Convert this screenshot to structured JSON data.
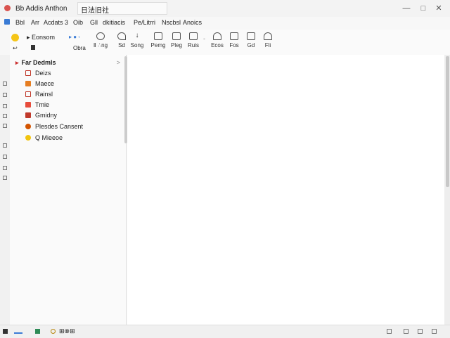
{
  "window": {
    "title": "Bb Addis Anthon",
    "title_field": "日法旧社",
    "controls": {
      "minimize": "—",
      "maximize": "□",
      "close": "✕"
    }
  },
  "menubar": {
    "items": [
      "Bbl",
      "Arr",
      "Acdats",
      "3",
      "Oib",
      "Gll",
      "dkitiacis",
      "Pe/Litrri",
      "Nscbsl",
      "Anoics"
    ]
  },
  "toolbar": {
    "group1": {
      "top": "Eonsom",
      "bottom": "Obra"
    },
    "buttons": [
      {
        "icon": "search-icon",
        "label": "Ⅱ ∴ng"
      },
      {
        "icon": "rotate-icon",
        "label": "Sd"
      },
      {
        "icon": "download-icon",
        "label": "Song"
      },
      {
        "icon": "clipboard-icon",
        "label": "Pemg"
      },
      {
        "icon": "image-icon",
        "label": "Pleg"
      },
      {
        "icon": "frame-icon",
        "label": "Ruis"
      },
      {
        "icon": "home-icon",
        "label": "Ecos"
      },
      {
        "icon": "share-icon",
        "label": "Fos"
      },
      {
        "icon": "layout-icon",
        "label": "Gd"
      },
      {
        "icon": "home-outline-icon",
        "label": "Fli"
      }
    ]
  },
  "sidebar": {
    "header": "Far Dedmls",
    "items": [
      {
        "label": "Deizs",
        "color": "#c0392b",
        "icon": "document-icon"
      },
      {
        "label": "Maece",
        "color": "#e67e22",
        "icon": "folder-icon"
      },
      {
        "label": "Rainsl",
        "color": "#c0392b",
        "icon": "bookmark-icon"
      },
      {
        "label": "Tmie",
        "color": "#e74c3c",
        "icon": "flag-icon"
      },
      {
        "label": "Gmidny",
        "color": "#c0392b",
        "icon": "box-icon"
      },
      {
        "label": "Plesdes Cansent",
        "color": "#d35400",
        "icon": "lock-icon"
      },
      {
        "label": "Q Mieeoe",
        "color": "#f1c40f",
        "icon": "face-icon"
      }
    ]
  },
  "statusbar": {
    "text": "⊞⊗⊞"
  },
  "colors": {
    "accent": "#3a7bd5",
    "brand": "#d9534f"
  }
}
